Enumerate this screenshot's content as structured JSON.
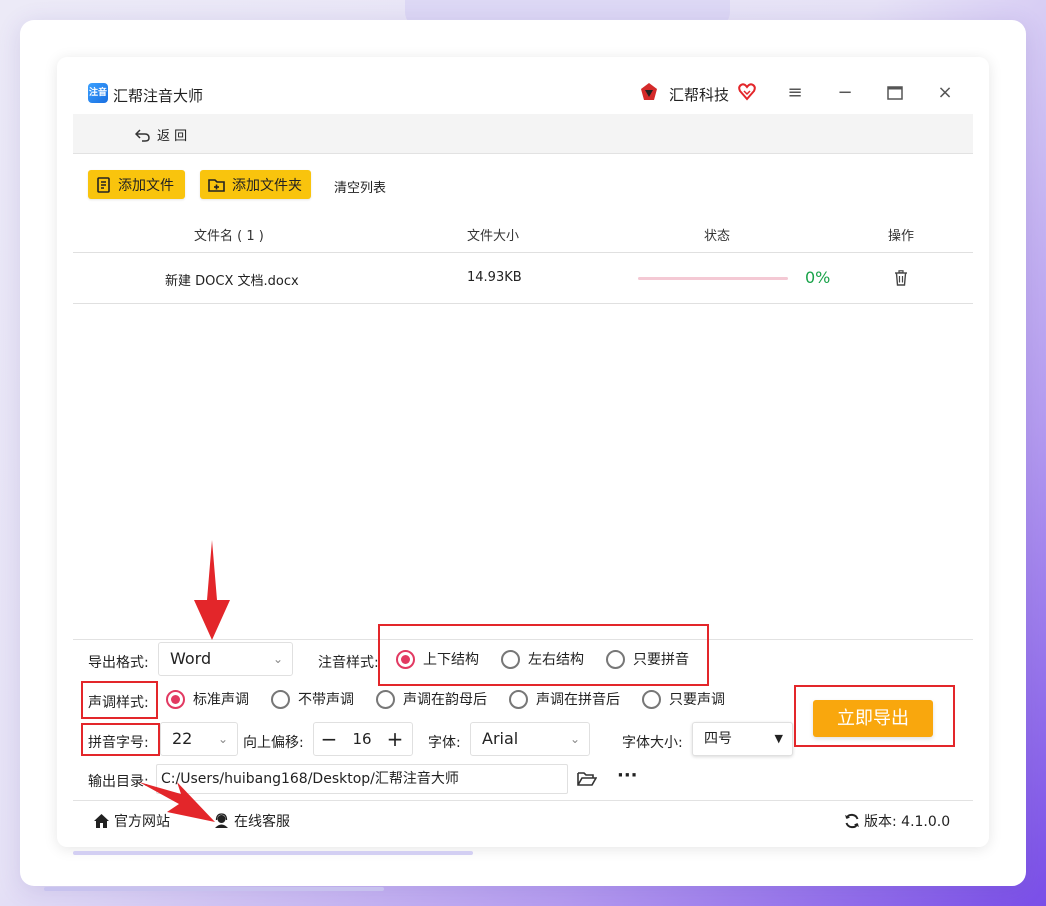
{
  "app": {
    "logo_text": "注音",
    "title": "汇帮注音大师",
    "brand": "汇帮科技"
  },
  "nav": {
    "back_label": "返 回"
  },
  "toolbar": {
    "add_file": "添加文件",
    "add_folder": "添加文件夹",
    "clear_list": "清空列表"
  },
  "table": {
    "headers": {
      "name": "文件名 ( 1 )",
      "size": "文件大小",
      "status": "状态",
      "action": "操作"
    },
    "rows": [
      {
        "name": "新建 DOCX 文档.docx",
        "size": "14.93KB",
        "progress": 0,
        "progress_text": "0%"
      }
    ]
  },
  "settings": {
    "export_format_label": "导出格式:",
    "export_format_value": "Word",
    "annotation_style_label": "注音样式:",
    "annotation_options": [
      "上下结构",
      "左右结构",
      "只要拼音"
    ],
    "annotation_selected": 0,
    "tone_style_label": "声调样式:",
    "tone_options": [
      "标准声调",
      "不带声调",
      "声调在韵母后",
      "声调在拼音后",
      "只要声调"
    ],
    "tone_selected": 0,
    "pinyin_size_label": "拼音字号:",
    "pinyin_size_value": "22",
    "offset_label": "向上偏移:",
    "offset_value": "16",
    "font_label": "字体:",
    "font_value": "Arial",
    "font_size_label": "字体大小:",
    "font_size_value": "四号",
    "output_dir_label": "输出目录:",
    "output_dir_value": "C:/Users/huibang168/Desktop/汇帮注音大师",
    "more_label": "···",
    "export_button": "立即导出"
  },
  "footer": {
    "website": "官方网站",
    "support": "在线客服",
    "version": "版本: 4.1.0.0"
  },
  "colors": {
    "accent_yellow": "#f9c40d",
    "export_orange": "#f9a70d",
    "radio_pink": "#e23a62",
    "progress_green": "#1aa34a",
    "highlight_red": "#e3262a"
  }
}
